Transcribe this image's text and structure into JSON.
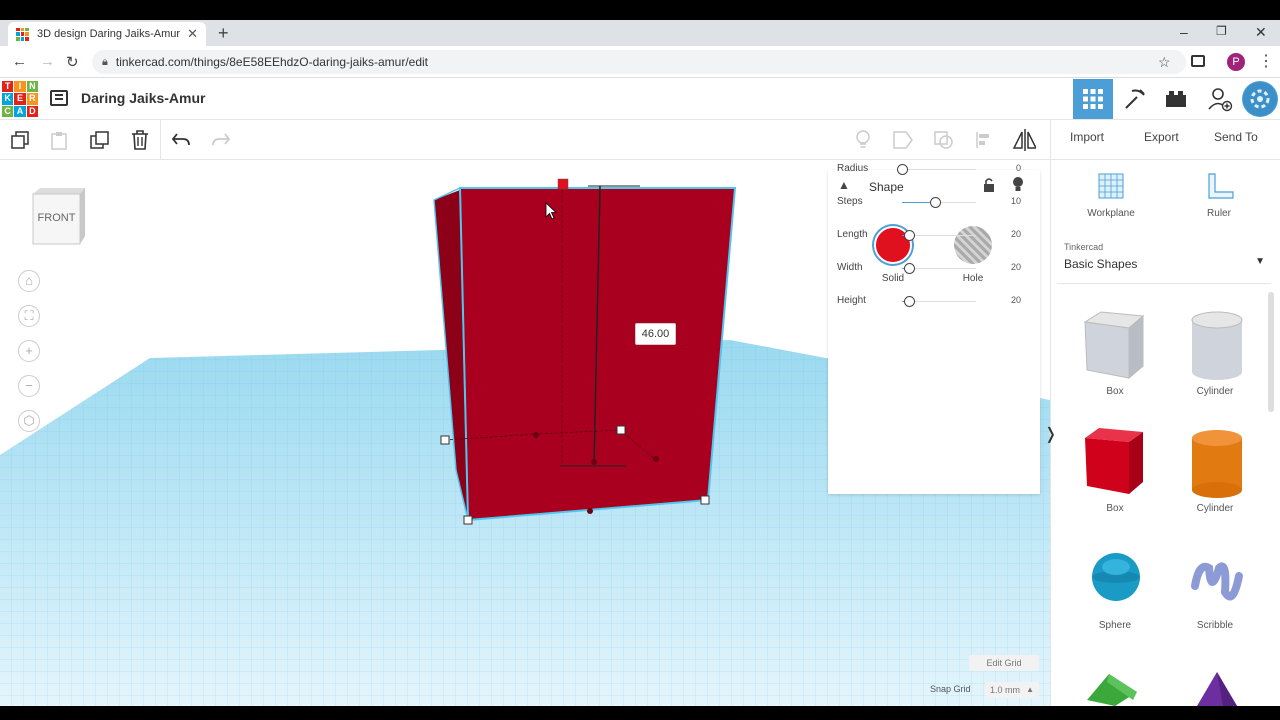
{
  "browser": {
    "tab_title": "3D design Daring Jaiks-Amur | Ti",
    "url": "tinkercad.com/things/8eE58EEhdzO-daring-jaiks-amur/edit",
    "profile_initial": "P"
  },
  "header": {
    "logo_letters": [
      "T",
      "I",
      "N",
      "K",
      "E",
      "R",
      "C",
      "A",
      "D"
    ],
    "design_name": "Daring Jaiks-Amur"
  },
  "toolbar": {
    "import_label": "Import",
    "export_label": "Export",
    "send_to_label": "Send To"
  },
  "viewcube": {
    "face_label": "FRONT"
  },
  "dimension_label": "46.00",
  "inspector": {
    "title": "Shape",
    "solid_label": "Solid",
    "hole_label": "Hole",
    "solid_color": "#e0101f",
    "properties": [
      {
        "label": "Radius",
        "value": "0",
        "fraction": 0.0
      },
      {
        "label": "Steps",
        "value": "10",
        "fraction": 0.45
      },
      {
        "label": "Length",
        "value": "20",
        "fraction": 0.09
      },
      {
        "label": "Width",
        "value": "20",
        "fraction": 0.09
      },
      {
        "label": "Height",
        "value": "20",
        "fraction": 0.09
      }
    ]
  },
  "rightpanel": {
    "workplane_label": "Workplane",
    "ruler_label": "Ruler",
    "library_source": "Tinkercad",
    "library_name": "Basic Shapes",
    "shapes": [
      {
        "label": "Box"
      },
      {
        "label": "Cylinder"
      },
      {
        "label": "Box"
      },
      {
        "label": "Cylinder"
      },
      {
        "label": "Sphere"
      },
      {
        "label": "Scribble"
      }
    ]
  },
  "grid": {
    "edit_grid_label": "Edit Grid",
    "snap_grid_label": "Snap Grid",
    "snap_grid_value": "1.0 mm"
  },
  "colors": {
    "accent": "#4b9fd6",
    "shape_red": "#a8001e",
    "grid_blue": "#8ed4ee"
  }
}
